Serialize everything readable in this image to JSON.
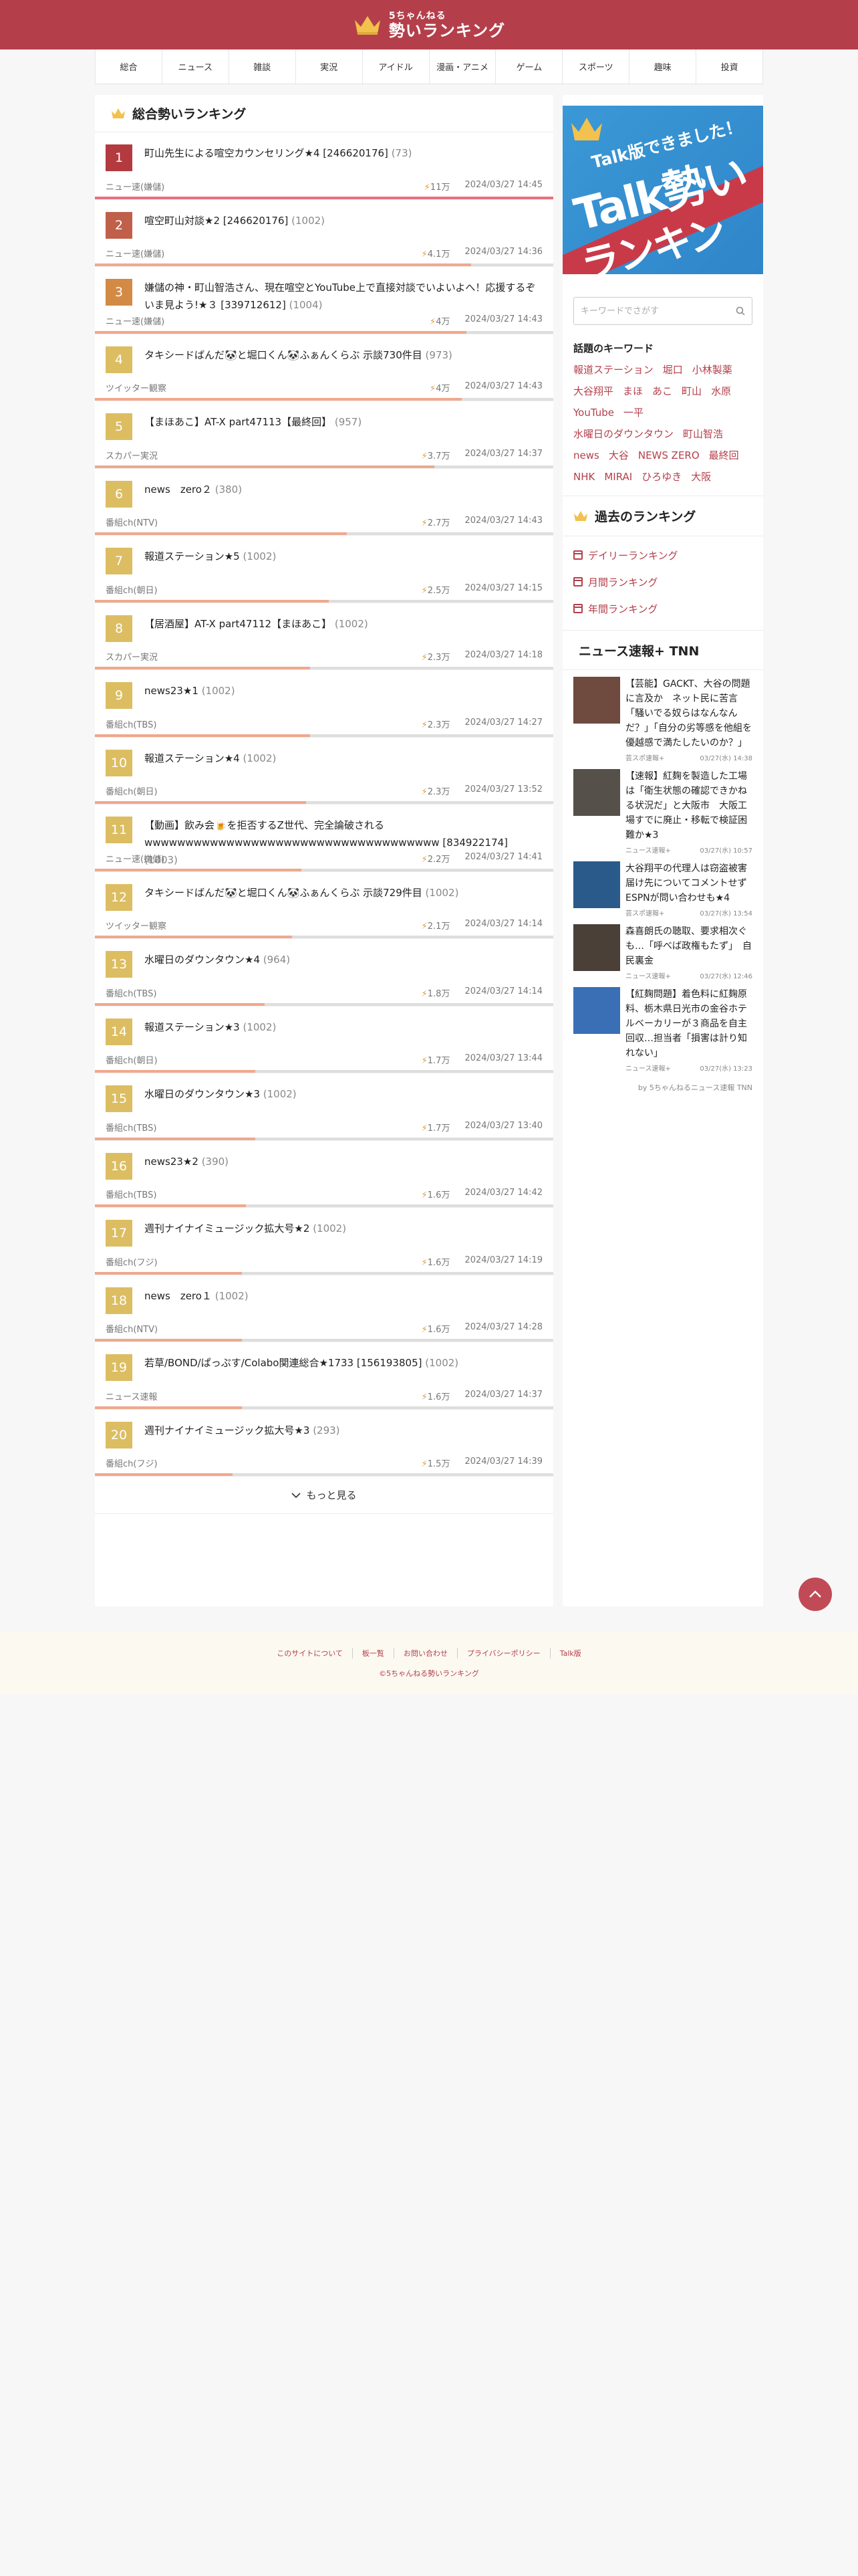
{
  "header": {
    "logo_small": "5ちゃんねる",
    "logo_big": "勢いランキング"
  },
  "nav": [
    "総合",
    "ニュース",
    "雑談",
    "実況",
    "アイドル",
    "漫画・アニメ",
    "ゲーム",
    "スポーツ",
    "趣味",
    "投資"
  ],
  "main": {
    "title": "総合勢いランキング",
    "more_label": "もっと見る",
    "items": [
      {
        "rank": "1",
        "title": "町山先生による喧空カウンセリング★4 [246620176]",
        "count": "(73)",
        "board": "ニュー速(嫌儲)",
        "ikioi": "11万",
        "time": "2024/03/27 14:45",
        "color": "#b33a3f",
        "bar": 1.0
      },
      {
        "rank": "2",
        "title": "喧空町山対談★2 [246620176]",
        "count": "(1002)",
        "board": "ニュー速(嫌儲)",
        "ikioi": "4.1万",
        "time": "2024/03/27 14:36",
        "color": "#c0604a",
        "bar": 0.82
      },
      {
        "rank": "3",
        "title": "嫌儲の神・町山智浩さん、現在喧空とYouTube上で直接対談でいよいよへ！応援するぞいま見よう!★３ [339712612]",
        "count": "(1004)",
        "board": "ニュー速(嫌儲)",
        "ikioi": "4万",
        "time": "2024/03/27 14:43",
        "color": "#d38a45",
        "bar": 0.81
      },
      {
        "rank": "4",
        "title": "タキシードばんだ🐼と堀口くん🐼ふぁんくらぶ 示談730件目",
        "count": "(973)",
        "board": "ツイッター観察",
        "ikioi": "4万",
        "time": "2024/03/27 14:43",
        "color": "#dcbd62",
        "bar": 0.8
      },
      {
        "rank": "5",
        "title": "【まほあこ】AT-X part47113【最終回】",
        "count": "(957)",
        "board": "スカパー実況",
        "ikioi": "3.7万",
        "time": "2024/03/27 14:37",
        "color": "#dcbd62",
        "bar": 0.74
      },
      {
        "rank": "6",
        "title": "news　zero２",
        "count": "(380)",
        "board": "番組ch(NTV)",
        "ikioi": "2.7万",
        "time": "2024/03/27 14:43",
        "color": "#dcbd62",
        "bar": 0.55
      },
      {
        "rank": "7",
        "title": "報道ステーション★5",
        "count": "(1002)",
        "board": "番組ch(朝日)",
        "ikioi": "2.5万",
        "time": "2024/03/27 14:15",
        "color": "#dcbd62",
        "bar": 0.51
      },
      {
        "rank": "8",
        "title": "【居酒屋】AT-X part47112【まほあこ】",
        "count": "(1002)",
        "board": "スカパー実況",
        "ikioi": "2.3万",
        "time": "2024/03/27 14:18",
        "color": "#dcbd62",
        "bar": 0.47
      },
      {
        "rank": "9",
        "title": "news23★1",
        "count": "(1002)",
        "board": "番組ch(TBS)",
        "ikioi": "2.3万",
        "time": "2024/03/27 14:27",
        "color": "#dcbd62",
        "bar": 0.47
      },
      {
        "rank": "10",
        "title": "報道ステーション★4",
        "count": "(1002)",
        "board": "番組ch(朝日)",
        "ikioi": "2.3万",
        "time": "2024/03/27 13:52",
        "color": "#dcbd62",
        "bar": 0.46
      },
      {
        "rank": "11",
        "title": "【動画】飲み会🍺を拒否するZ世代、完全論破される wwwwwwwwwwwwwwwwwwwwwwwwwwwwwwwwwwww [834922174]",
        "count": "(1003)",
        "board": "ニュー速(嫌儲)",
        "ikioi": "2.2万",
        "time": "2024/03/27 14:41",
        "color": "#dcbd62",
        "bar": 0.45
      },
      {
        "rank": "12",
        "title": "タキシードばんだ🐼と堀口くん🐼ふぁんくらぶ 示談729件目",
        "count": "(1002)",
        "board": "ツイッター観察",
        "ikioi": "2.1万",
        "time": "2024/03/27 14:14",
        "color": "#dcbd62",
        "bar": 0.43
      },
      {
        "rank": "13",
        "title": "水曜日のダウンタウン★4",
        "count": "(964)",
        "board": "番組ch(TBS)",
        "ikioi": "1.8万",
        "time": "2024/03/27 14:14",
        "color": "#dcbd62",
        "bar": 0.37
      },
      {
        "rank": "14",
        "title": "報道ステーション★3",
        "count": "(1002)",
        "board": "番組ch(朝日)",
        "ikioi": "1.7万",
        "time": "2024/03/27 13:44",
        "color": "#dcbd62",
        "bar": 0.35
      },
      {
        "rank": "15",
        "title": "水曜日のダウンタウン★3",
        "count": "(1002)",
        "board": "番組ch(TBS)",
        "ikioi": "1.7万",
        "time": "2024/03/27 13:40",
        "color": "#dcbd62",
        "bar": 0.35
      },
      {
        "rank": "16",
        "title": "news23★2",
        "count": "(390)",
        "board": "番組ch(TBS)",
        "ikioi": "1.6万",
        "time": "2024/03/27 14:42",
        "color": "#dcbd62",
        "bar": 0.33
      },
      {
        "rank": "17",
        "title": "週刊ナイナイミュージック拡大号★2",
        "count": "(1002)",
        "board": "番組ch(フジ)",
        "ikioi": "1.6万",
        "time": "2024/03/27 14:19",
        "color": "#dcbd62",
        "bar": 0.32
      },
      {
        "rank": "18",
        "title": "news　zero１",
        "count": "(1002)",
        "board": "番組ch(NTV)",
        "ikioi": "1.6万",
        "time": "2024/03/27 14:28",
        "color": "#dcbd62",
        "bar": 0.32
      },
      {
        "rank": "19",
        "title": "若草/BOND/ぱっぷす/Colabo関連総合★1733 [156193805]",
        "count": "(1002)",
        "board": "ニュース速報",
        "ikioi": "1.6万",
        "time": "2024/03/27 14:37",
        "color": "#dcbd62",
        "bar": 0.32
      },
      {
        "rank": "20",
        "title": "週刊ナイナイミュージック拡大号★3",
        "count": "(293)",
        "board": "番組ch(フジ)",
        "ikioi": "1.5万",
        "time": "2024/03/27 14:39",
        "color": "#dcbd62",
        "bar": 0.3
      }
    ]
  },
  "side": {
    "banner": {
      "line1": "Talk版できました！",
      "line2": "Talk勢い",
      "line3": "ランキング"
    },
    "search_placeholder": "キーワードでさがす",
    "keywords_title": "話題のキーワード",
    "keywords": [
      "報道ステーション",
      "堀口",
      "小林製薬",
      "大谷翔平",
      "まほ",
      "あこ",
      "町山",
      "水原",
      "YouTube",
      "一平",
      "水曜日のダウンタウン",
      "町山智浩",
      "news",
      "大谷",
      "NEWS ZERO",
      "最終回",
      "NHK",
      "MIRAI",
      "ひろゆき",
      "大阪"
    ],
    "past_title": "過去のランキング",
    "past_links": [
      "デイリーランキング",
      "月間ランキング",
      "年間ランキング"
    ],
    "news_title": "ニュース速報+ TNN",
    "news": [
      {
        "title": "【芸能】GACKT、大谷の問題に言及か　ネット民に苦言「騒いでる奴らはなんなんだ？」「自分の劣等感を他組を優越感で満たしたいのか？」",
        "source": "芸スポ速報+",
        "time": "03/27(水) 14:38",
        "thumb": "#6e4a3f"
      },
      {
        "title": "【速報】紅麹を製造した工場は「衛生状態の確認できかねる状況だ」と大阪市　大阪工場すでに廃止・移転で検証困難か★3",
        "source": "ニュース速報+",
        "time": "03/27(水) 10:57",
        "thumb": "#55504a"
      },
      {
        "title": "大谷翔平の代理人は窃盗被害届け先についてコメントせず　ESPNが問い合わせも★4",
        "source": "芸スポ速報+",
        "time": "03/27(水) 13:54",
        "thumb": "#2a5a8a"
      },
      {
        "title": "森喜朗氏の聴取、要求相次ぐも…「呼べば政権もたず」　自民裏金",
        "source": "ニュース速報+",
        "time": "03/27(水) 12:46",
        "thumb": "#4a4038"
      },
      {
        "title": "【紅麹問題】着色料に紅麹原料、栃木県日光市の金谷ホテルベーカリーが３商品を自主回収…担当者「損害は計り知れない」",
        "source": "ニュース速報+",
        "time": "03/27(水) 13:23",
        "thumb": "#3a6fb5"
      }
    ],
    "by": "by 5ちゃんねるニュース速報 TNN"
  },
  "footer": {
    "links": [
      "このサイトについて",
      "板一覧",
      "お問い合わせ",
      "プライバシーポリシー",
      "Talk版"
    ],
    "copyright": "©5ちゃんねる勢いランキング"
  }
}
